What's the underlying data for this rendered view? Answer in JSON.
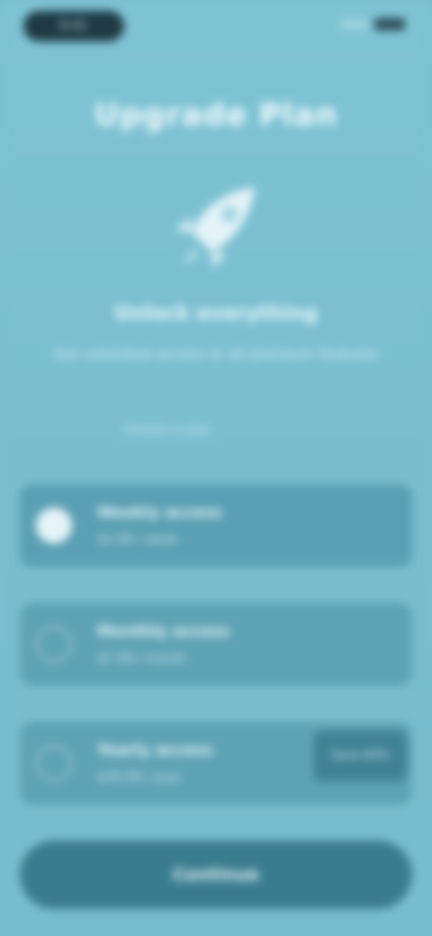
{
  "status_bar": {
    "time": "9:41",
    "signal_icon": "signal-icon",
    "battery_icon": "battery-icon"
  },
  "header": {
    "title": "Upgrade Plan"
  },
  "hero": {
    "icon": "rocket-icon",
    "title": "Unlock everything",
    "subtitle": "Get unlimited access to all premium features"
  },
  "plans": {
    "section_label": "Choose a plan",
    "items": [
      {
        "title": "Weekly access",
        "description": "$2.99 / week",
        "selected": true
      },
      {
        "title": "Monthly access",
        "description": "$7.99 / month",
        "selected": false
      },
      {
        "title": "Yearly access",
        "description": "$39.99 / year",
        "selected": false,
        "badge": "Save 60%"
      }
    ]
  },
  "cta": {
    "label": "Continue"
  },
  "colors": {
    "background": "#7bbfd1",
    "card": "#4f97ab",
    "button": "#3a7c8f"
  }
}
